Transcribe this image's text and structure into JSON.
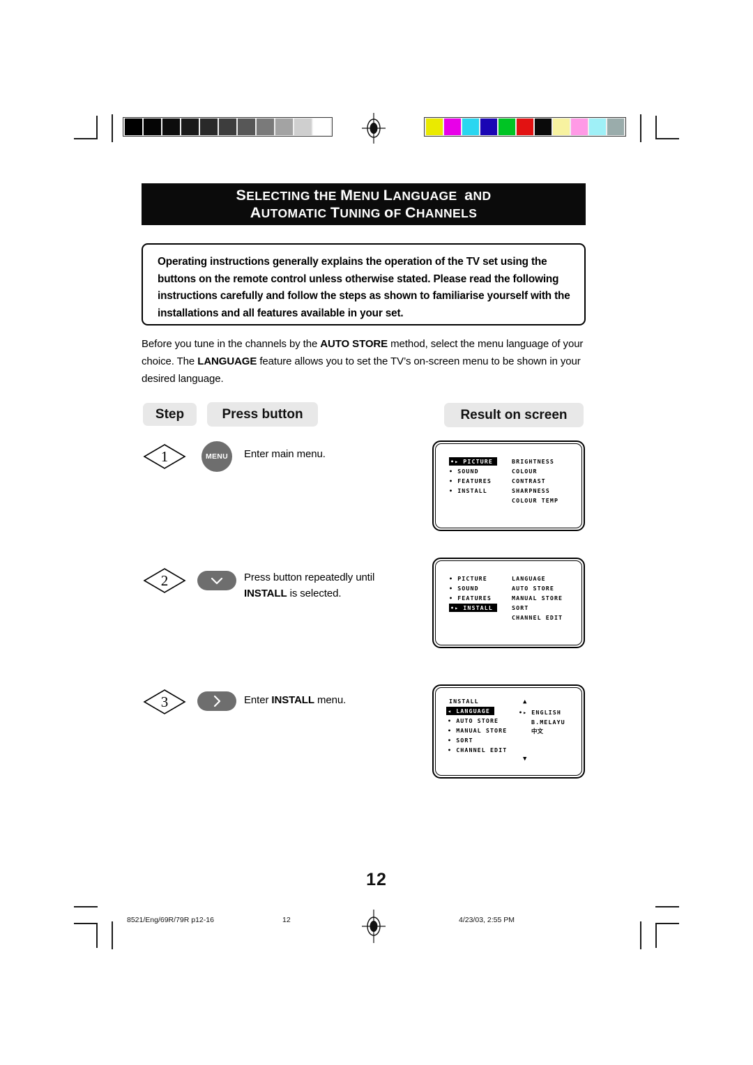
{
  "document": {
    "page_number": "12",
    "title_line1": "Selecting the Menu Language  and",
    "title_line2": "Automatic Tuning of Channels",
    "intro_note": "Operating instructions generally explains the operation of the TV set using the buttons on the remote control unless otherwise stated.  Please read the following instructions carefully and follow the steps as shown to familiarise yourself with the installations and all features available in your set.",
    "body_paragraph": {
      "part1": "Before you tune in the channels by the ",
      "bold1": "AUTO STORE",
      "part2": " method, select the menu language of your choice. The ",
      "bold2": "LANGUAGE",
      "part3": " feature allows you to set the TV’s on-screen menu to be shown in your desired language."
    }
  },
  "columns": {
    "step_label": "Step",
    "press_button_label": "Press button",
    "result_label": "Result on screen"
  },
  "steps": [
    {
      "number": "1",
      "button_label": "MENU",
      "button_icon": "menu-text-button",
      "instruction_prefix": "Enter main menu.",
      "instruction_bold": "",
      "instruction_suffix": ""
    },
    {
      "number": "2",
      "button_label": "",
      "button_icon": "chevron-down-icon",
      "instruction_prefix": "Press button repeatedly until",
      "instruction_bold": "INSTALL",
      "instruction_suffix": " is selected."
    },
    {
      "number": "3",
      "button_label": "",
      "button_icon": "chevron-right-icon",
      "instruction_prefix": "Enter ",
      "instruction_bold": "INSTALL",
      "instruction_suffix": " menu."
    }
  ],
  "tv_screens": [
    {
      "id": "screen-main-menu",
      "left_column": [
        {
          "text": "PICTURE",
          "bullet": "•▸",
          "highlighted": true
        },
        {
          "text": "SOUND",
          "bullet": "•",
          "highlighted": false
        },
        {
          "text": "FEATURES",
          "bullet": "•",
          "highlighted": false
        },
        {
          "text": "INSTALL",
          "bullet": "•",
          "highlighted": false
        }
      ],
      "right_column": [
        "BRIGHTNESS",
        "COLOUR",
        "CONTRAST",
        "SHARPNESS",
        "COLOUR TEMP"
      ]
    },
    {
      "id": "screen-install-selected",
      "left_column": [
        {
          "text": "PICTURE",
          "bullet": "•",
          "highlighted": false
        },
        {
          "text": "SOUND",
          "bullet": "•",
          "highlighted": false
        },
        {
          "text": "FEATURES",
          "bullet": "•",
          "highlighted": false
        },
        {
          "text": "INSTALL",
          "bullet": "•▸",
          "highlighted": true
        }
      ],
      "right_column": [
        "LANGUAGE",
        "AUTO STORE",
        "MANUAL STORE",
        "SORT",
        "CHANNEL EDIT"
      ]
    },
    {
      "id": "screen-install-menu",
      "heading": "INSTALL",
      "left_column": [
        {
          "text": "LANGUAGE",
          "bullet": "◂",
          "highlighted": true
        },
        {
          "text": "AUTO STORE",
          "bullet": "•",
          "highlighted": false
        },
        {
          "text": "MANUAL STORE",
          "bullet": "•",
          "highlighted": false
        },
        {
          "text": "SORT",
          "bullet": "•",
          "highlighted": false
        },
        {
          "text": "CHANNEL EDIT",
          "bullet": "•",
          "highlighted": false
        }
      ],
      "right_column": [
        "ENGLISH",
        "B.MELAYU",
        "中文"
      ],
      "right_marker": "•▸",
      "scroll_up": "▲",
      "scroll_down": "▼"
    }
  ],
  "footer": {
    "left": "8521/Eng/69R/79R p12-16",
    "center": "12",
    "right": "4/23/03, 2:55 PM"
  },
  "calibration": {
    "grayscale": [
      "#000000",
      "#050505",
      "#0d0d0d",
      "#1a1a1a",
      "#292929",
      "#3d3d3d",
      "#575757",
      "#7a7a7a",
      "#a3a3a3",
      "#cfcfcf",
      "#ffffff"
    ],
    "colors": [
      "#eaea00",
      "#e800e8",
      "#2ad6f0",
      "#1a06b4",
      "#00c424",
      "#e21212",
      "#0a0a0a",
      "#f7f2a0",
      "#ff9ae6",
      "#9ff0f7",
      "#9aacab"
    ]
  }
}
